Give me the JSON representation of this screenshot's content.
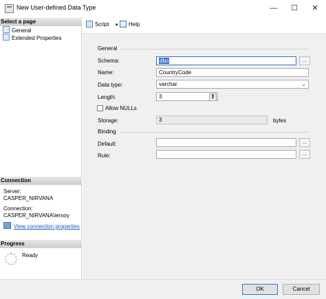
{
  "window": {
    "title": "New User-defined Data Type"
  },
  "sidebar": {
    "select_page_header": "Select a page",
    "pages": [
      {
        "label": "General"
      },
      {
        "label": "Extended Properties"
      }
    ],
    "connection_header": "Connection",
    "server_label": "Server:",
    "server_value": "CASPER_NIRVANA",
    "connection_label": "Connection:",
    "connection_value": "CASPER_NIRVANA\\iersoy",
    "view_connection_link": "View connection properties",
    "progress_header": "Progress",
    "progress_status": "Ready"
  },
  "toolbar": {
    "script_label": "Script",
    "help_label": "Help"
  },
  "form": {
    "general_group": "General",
    "schema_label": "Schema:",
    "schema_value": "dbo",
    "name_label": "Name:",
    "name_value": "CountryCode",
    "datatype_label": "Data type:",
    "datatype_value": "varchar",
    "length_label": "Length:",
    "length_value": "3",
    "allow_nulls_label": "Allow NULLs",
    "allow_nulls_checked": false,
    "storage_label": "Storage:",
    "storage_value": "3",
    "storage_unit": "bytes",
    "binding_group": "Binding",
    "default_label": "Default:",
    "default_value": "",
    "rule_label": "Rule:",
    "rule_value": "",
    "ellipsis": "..."
  },
  "footer": {
    "ok_label": "OK",
    "cancel_label": "Cancel"
  }
}
